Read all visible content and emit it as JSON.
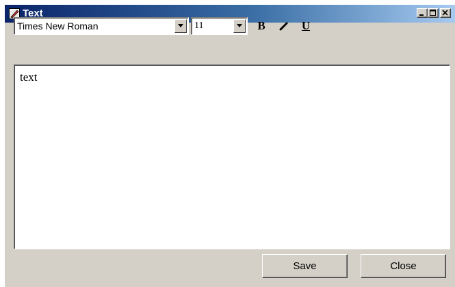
{
  "window": {
    "title": "Text",
    "icon": "text-editor-icon",
    "caption_buttons": [
      "minimize-icon",
      "maximize-icon",
      "close-icon"
    ]
  },
  "toolbar": {
    "font_family": "Times New Roman",
    "font_size": "11",
    "bold_label": "B",
    "italic_label": "/",
    "underline_label": "U"
  },
  "editor": {
    "content": "text"
  },
  "footer": {
    "save_label": "Save",
    "close_label": "Close"
  },
  "colors": {
    "titlebar_start": "#0a246a",
    "titlebar_end": "#a6caf0",
    "window_face": "#d4d0c8"
  }
}
